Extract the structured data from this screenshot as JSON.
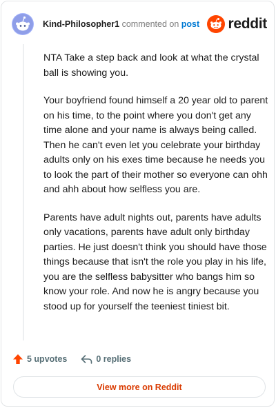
{
  "comment": {
    "username": "Kind-Philosopher1",
    "action_text": "commented on",
    "post_link": "post",
    "paragraphs": [
      "NTA Take a step back and look at what the crystal ball is showing you.",
      "Your boyfriend found himself a 20 year old to parent on his time, to the point where you don't get any time alone and your name is always being called. Then he can't even let you celebrate your birthday adults only on his exes time because he needs you to look the part of their mother so everyone can ohh and ahh about how selfless you are.",
      "Parents have adult nights out, parents have adults only vacations, parents have adult only birthday parties. He just doesn't think you should have those things because that isn't the role you play in his life, you are the selfless babysitter who bangs him so know your role. And now he is angry because you stood up for yourself the teeniest tiniest bit."
    ],
    "upvotes": "5 upvotes",
    "replies": "0 replies"
  },
  "brand": {
    "logo_text": "reddit",
    "accent_color": "#ff4500",
    "link_color": "#0079d3",
    "cta_color": "#d93a00"
  },
  "footer": {
    "view_more_label": "View more on Reddit"
  },
  "icons": {
    "avatar": "snoo-avatar-icon",
    "logo": "reddit-logo-icon",
    "upvote": "upvote-arrow-icon",
    "reply": "reply-arrow-icon"
  }
}
